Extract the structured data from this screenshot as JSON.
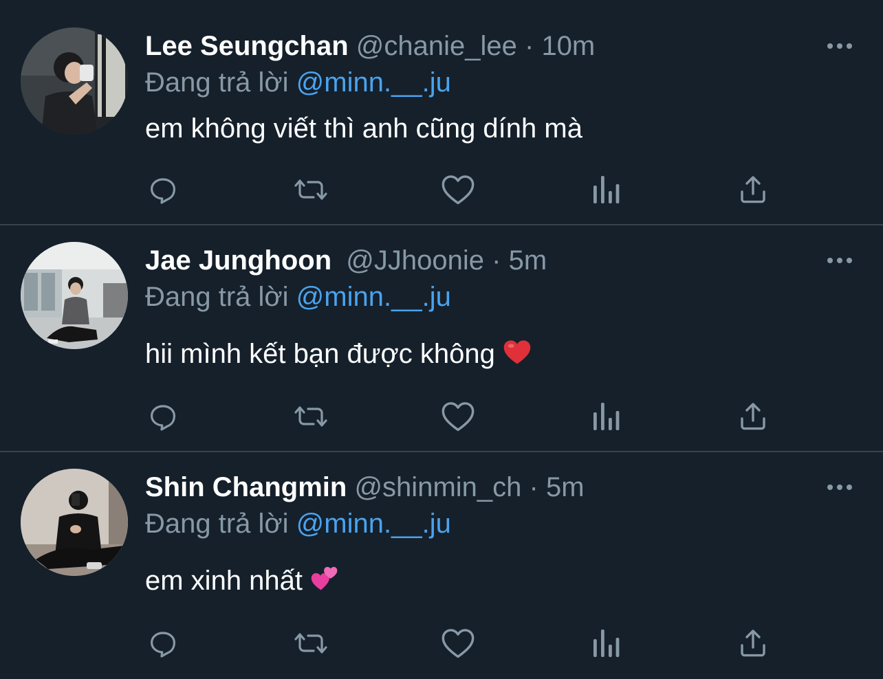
{
  "colors": {
    "background": "#15202b",
    "divider": "#38444d",
    "secondary_text": "#8899a6",
    "mention": "#4aa3ee",
    "icon": "#8899a6"
  },
  "tweets": [
    {
      "name": "Lee Seungchan",
      "handle": "@chanie_lee",
      "separator": "·",
      "time": "10m",
      "reply_prefix": "Đang trả lời",
      "reply_to": "@minn.__.ju",
      "text": "em không viết thì anh cũng dính mà",
      "emoji": ""
    },
    {
      "name": "Jae Junghoon",
      "handle": "@JJhoonie",
      "separator": "·",
      "time": "5m",
      "reply_prefix": "Đang trả lời",
      "reply_to": "@minn.__.ju",
      "text": "hii mình kết bạn được không",
      "emoji": "red-heart-emoji"
    },
    {
      "name": "Shin Changmin",
      "handle": "@shinmin_ch",
      "separator": "·",
      "time": "5m",
      "reply_prefix": "Đang trả lời",
      "reply_to": "@minn.__.ju",
      "text": "em xinh nhất",
      "emoji": "two-hearts-emoji"
    }
  ],
  "action_icons": [
    "reply-icon",
    "retweet-icon",
    "like-icon",
    "analytics-icon",
    "share-icon"
  ],
  "more_icon": "more-options-icon"
}
